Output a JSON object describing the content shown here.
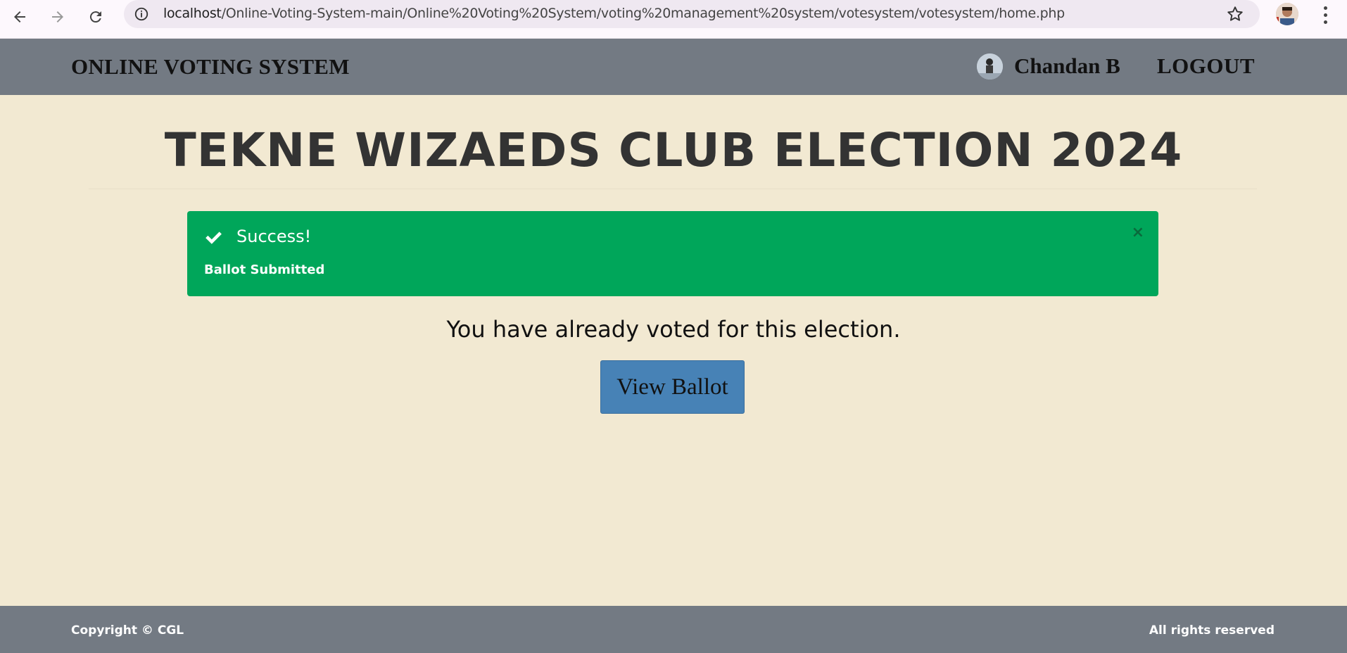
{
  "browser": {
    "url_host": "localhost",
    "url_path": "/Online-Voting-System-main/Online%20Voting%20System/voting%20management%20system/votesystem/votesystem/home.php",
    "icons": [
      "back-arrow-icon",
      "forward-arrow-icon",
      "reload-icon",
      "site-info-icon",
      "bookmark-star-icon",
      "profile-avatar-icon",
      "kebab-menu-icon"
    ]
  },
  "header": {
    "brand": "ONLINE VOTING SYSTEM",
    "user_name": "Chandan B",
    "logout_label": "LOGOUT"
  },
  "main": {
    "title": "TEKNE WIZAEDS CLUB ELECTION 2024",
    "alert": {
      "title": "Success!",
      "message": "Ballot Submitted",
      "close_symbol": "×",
      "color": "#00a65a"
    },
    "voted_message": "You have already voted for this election.",
    "view_ballot_label": "View Ballot"
  },
  "footer": {
    "copyright": "Copyright © CGL",
    "rights": "All rights reserved"
  },
  "colors": {
    "background": "#f2e9d2",
    "header_footer": "#737a83",
    "button": "#4782b6"
  }
}
